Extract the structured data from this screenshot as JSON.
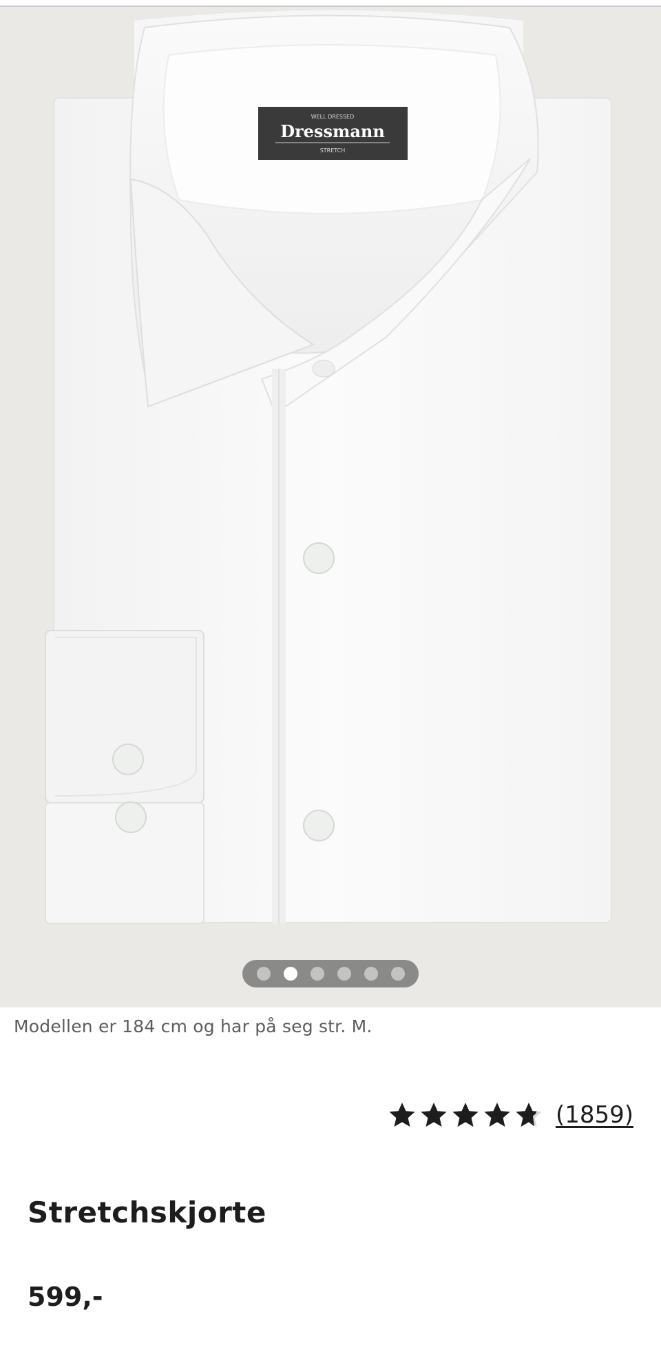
{
  "product": {
    "image_alt": "Hvit stretchskjorte",
    "label": {
      "top_text": "WELL DRESSED",
      "brand": "Dressmann",
      "bottom_text": "STRETCH"
    },
    "carousel": {
      "total": 6,
      "active_index": 1
    },
    "model_note": "Modellen er 184 cm og har på seg str. M.",
    "rating": {
      "value": 4.5,
      "max": 5,
      "count_text": "(1859)"
    },
    "title": "Stretchskjorte",
    "price": "599,-"
  },
  "colors": {
    "hero_bg": "#ebe9e6",
    "text": "#1d1d1d",
    "muted_text": "#5c5c5c",
    "dots_bg": "#8a8a88",
    "dot_inactive": "#c3c3c1",
    "dot_active": "#ffffff"
  },
  "icons": {
    "star": "star-icon",
    "half_star": "star-half-icon"
  }
}
